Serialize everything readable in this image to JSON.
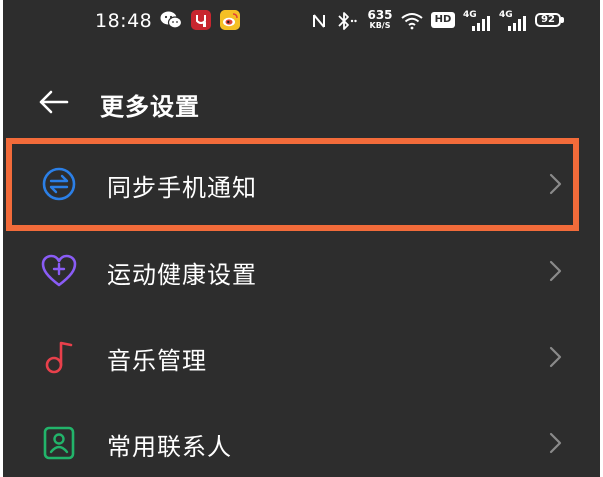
{
  "status_bar": {
    "time": "18:48",
    "net_speed_value": "635",
    "net_speed_unit": "KB/S",
    "network_1": "4G",
    "network_2": "4G",
    "battery": "92",
    "hd_label": "HD",
    "icons": [
      "wechat-icon",
      "youku-icon",
      "weibo-icon",
      "nfc-icon",
      "bluetooth-icon",
      "wifi-icon",
      "hd-icon",
      "signal-icon",
      "battery-icon"
    ]
  },
  "header": {
    "title": "更多设置"
  },
  "menu": {
    "items": [
      {
        "label": "同步手机通知",
        "icon": "sync-icon",
        "icon_color": "#2b7fe6"
      },
      {
        "label": "运动健康设置",
        "icon": "heart-plus-icon",
        "icon_color": "#8a5cf6"
      },
      {
        "label": "音乐管理",
        "icon": "music-note-icon",
        "icon_color": "#e8404b"
      },
      {
        "label": "常用联系人",
        "icon": "contact-icon",
        "icon_color": "#22b46a"
      }
    ]
  },
  "colors": {
    "background": "#2d2d2d",
    "highlight": "#f26b3a",
    "text": "#ffffff",
    "chevron": "#8a8a8a"
  }
}
